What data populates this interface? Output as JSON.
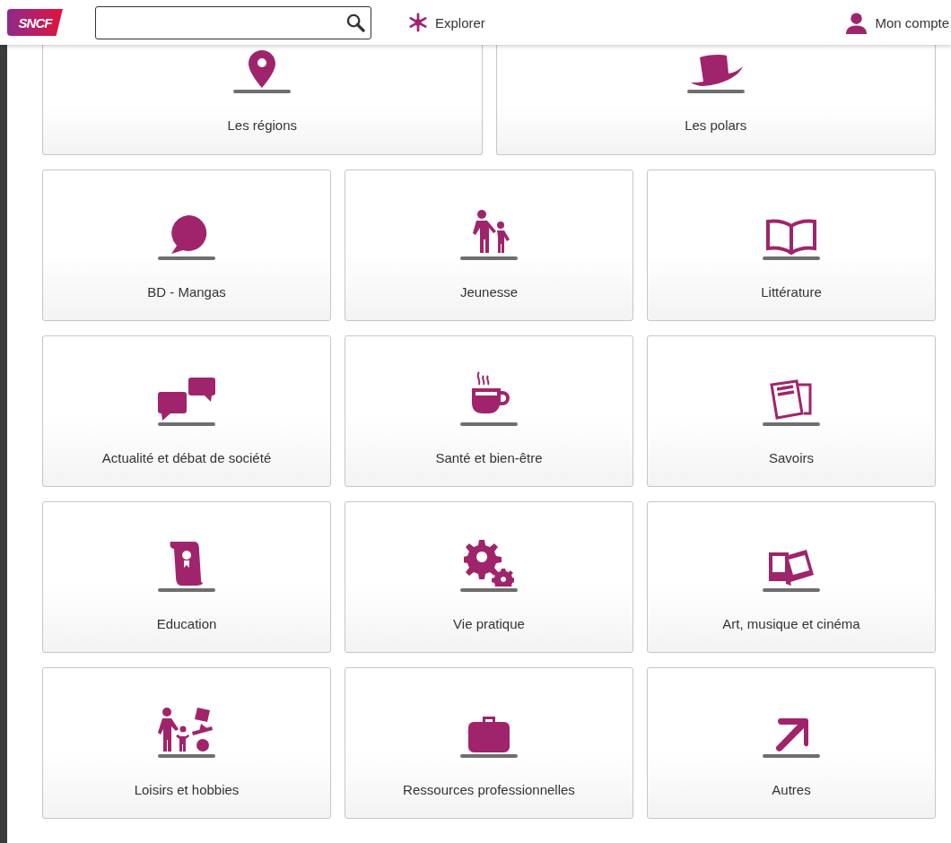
{
  "header": {
    "logo": "SNCF",
    "explore": "Explorer",
    "account": "Mon compte"
  },
  "featured": [
    {
      "label": "Les régions"
    },
    {
      "label": "Les polars"
    }
  ],
  "categories": [
    {
      "label": "BD - Mangas"
    },
    {
      "label": "Jeunesse"
    },
    {
      "label": "Littérature"
    },
    {
      "label": "Actualité et débat de société"
    },
    {
      "label": "Santé et bien-être"
    },
    {
      "label": "Savoirs"
    },
    {
      "label": "Education"
    },
    {
      "label": "Vie pratique"
    },
    {
      "label": "Art, musique et cinéma"
    },
    {
      "label": "Loisirs et hobbies"
    },
    {
      "label": "Ressources professionnelles"
    },
    {
      "label": "Autres"
    }
  ]
}
